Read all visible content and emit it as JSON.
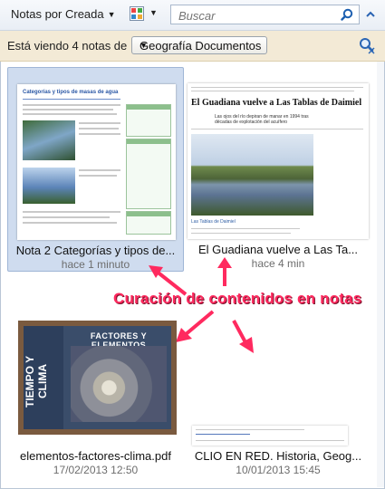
{
  "toolbar": {
    "sort_label": "Notas por Creada",
    "search_placeholder": "Buscar"
  },
  "filter": {
    "label": "Está viendo 4 notas de",
    "notebook": "Geografía Documentos"
  },
  "notes": [
    {
      "title": "Nota 2 Categorías y tipos de...",
      "date": "hace 1 minuto",
      "thumb_heading": "Categorías y tipos de masas de agua"
    },
    {
      "title": "El Guadiana vuelve a Las Ta...",
      "date": "hace 4 min",
      "thumb_heading": "El Guadiana vuelve a Las Tablas de Daimiel",
      "thumb_subheading": "Las ojos del río depiran de manar en 1994 tras décadas de explotación del acuífero",
      "thumb_caption": "Las Tablas de Daimiel"
    },
    {
      "title": "elementos-factores-clima.pdf",
      "date": "17/02/2013 12:50",
      "cover_side_text": "TIEMPO Y CLIMA",
      "cover_title": "FACTORES Y ELEMENTOS"
    },
    {
      "title": "CLIO EN RED. Historia, Geog...",
      "date": "10/01/2013 15:45"
    }
  ],
  "annotation": "Curación de contenidos en notas",
  "colors": {
    "selected_bg": "#cfdcef",
    "filter_bar": "#f3ead6",
    "annotation": "#ff2a5f"
  },
  "icons": [
    "view-options-icon",
    "search-icon",
    "collapse-icon",
    "clear-filter-icon"
  ]
}
